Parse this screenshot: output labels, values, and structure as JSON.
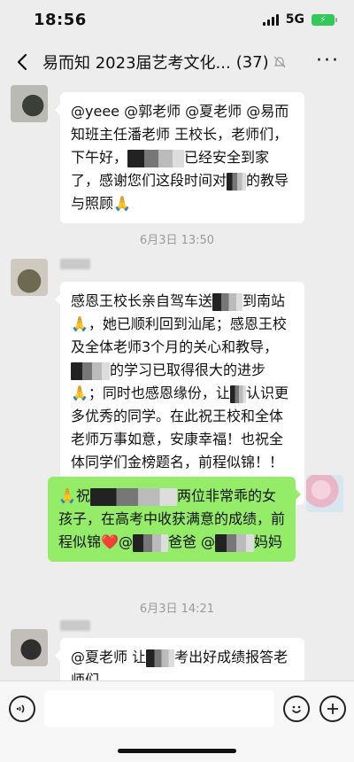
{
  "status": {
    "time": "18:56",
    "network": "5G",
    "battery": "⚡"
  },
  "nav": {
    "back_icon": "chevron-left-icon",
    "title": "易而知 2023届艺考文化...",
    "count": "(37)",
    "mute_icon": "bell-off-icon",
    "more_icon": "more-icon"
  },
  "messages": [
    {
      "type": "received",
      "text_parts": [
        "@yeee @郭老师 @夏老师 @易而知班主任潘老师 王校长，老师们，下午好，",
        "已经安全到家了，感谢您们这段时间对",
        "的教导与照顾",
        "🙏"
      ]
    },
    {
      "type": "timestamp",
      "text": "6月3日 13:50"
    },
    {
      "type": "received",
      "text_parts": [
        "感恩王校长亲自驾车送",
        "到南站",
        "🙏",
        "，她已顺利回到汕尾；感恩王校及全体老师3个月的关心和教导，",
        "的学习已取得很大的进步",
        "🙏",
        "；同时也感恩缘份，让",
        "认识更多优秀的同学。在此祝王校和全体老师万事如意，安康幸福！也祝全体同学们金榜题名，前程似锦！！",
        "❤️",
        "✊"
      ]
    },
    {
      "type": "sent",
      "text_parts": [
        "🙏",
        "祝",
        "两位非常乖的女孩子，在高考中收获满意的成绩，前程似锦",
        "❤️",
        "@",
        "爸爸 @",
        "妈妈"
      ]
    },
    {
      "type": "timestamp",
      "text": "6月3日 14:21"
    },
    {
      "type": "received",
      "text_parts": [
        "@夏老师 让",
        "考出好成绩报答老师们。"
      ]
    }
  ],
  "input_bar": {
    "voice_icon": "voice-icon",
    "emoji_icon": "emoji-icon",
    "plus_icon": "plus-icon",
    "placeholder": ""
  },
  "colors": {
    "background": "#ededed",
    "bubble_in": "#ffffff",
    "bubble_out": "#95ec69",
    "heart": "#e8405a"
  }
}
